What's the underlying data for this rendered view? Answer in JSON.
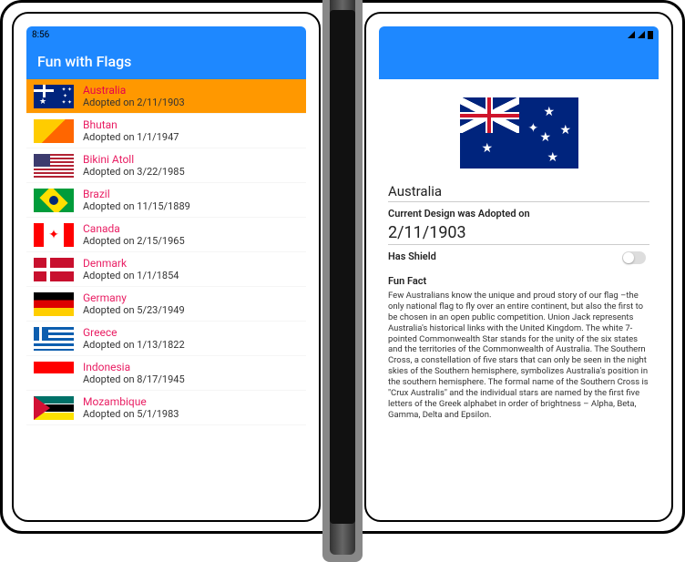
{
  "status": {
    "time": "8:56"
  },
  "app": {
    "title": "Fun with Flags"
  },
  "countries": [
    {
      "name": "Australia",
      "adopted": "Adopted on 2/11/1903",
      "flag": "fl-au",
      "selected": true
    },
    {
      "name": "Bhutan",
      "adopted": "Adopted on 1/1/1947",
      "flag": "fl-bt"
    },
    {
      "name": "Bikini Atoll",
      "adopted": "Adopted on 3/22/1985",
      "flag": "fl-ba"
    },
    {
      "name": "Brazil",
      "adopted": "Adopted on 11/15/1889",
      "flag": "fl-br"
    },
    {
      "name": "Canada",
      "adopted": "Adopted on 2/15/1965",
      "flag": "fl-ca"
    },
    {
      "name": "Denmark",
      "adopted": "Adopted on 1/1/1854",
      "flag": "fl-dk"
    },
    {
      "name": "Germany",
      "adopted": "Adopted on 5/23/1949",
      "flag": "fl-de"
    },
    {
      "name": "Greece",
      "adopted": "Adopted on 1/13/1822",
      "flag": "fl-gr"
    },
    {
      "name": "Indonesia",
      "adopted": "Adopted on 8/17/1945",
      "flag": "fl-id"
    },
    {
      "name": "Mozambique",
      "adopted": "Adopted on 5/1/1983",
      "flag": "fl-mz"
    }
  ],
  "detail": {
    "name": "Australia",
    "adopted_label": "Current Design was Adopted on",
    "adopted_date": "2/11/1903",
    "has_shield_label": "Has Shield",
    "fun_fact_label": "Fun Fact",
    "fun_fact": "Few Australians know the unique and proud story of our flag –the only national flag to fly over an entire continent, but also the first to be chosen in an open public competition. Union Jack represents Australia's historical links with the United Kingdom. The white 7-pointed Commonwealth Star stands for the unity of the six states and the territories of the Commonwealth of Australia. The Southern Cross, a constellation of five stars that can only be seen in the night skies of the Southern hemisphere, symbolizes Australia's position in the southern hemisphere. The formal name of the Southern Cross is \"Crux Australis\" and the individual stars are named by the first five letters of the Greek alphabet in order of brightness – Alpha, Beta, Gamma, Delta and Epsilon."
  }
}
